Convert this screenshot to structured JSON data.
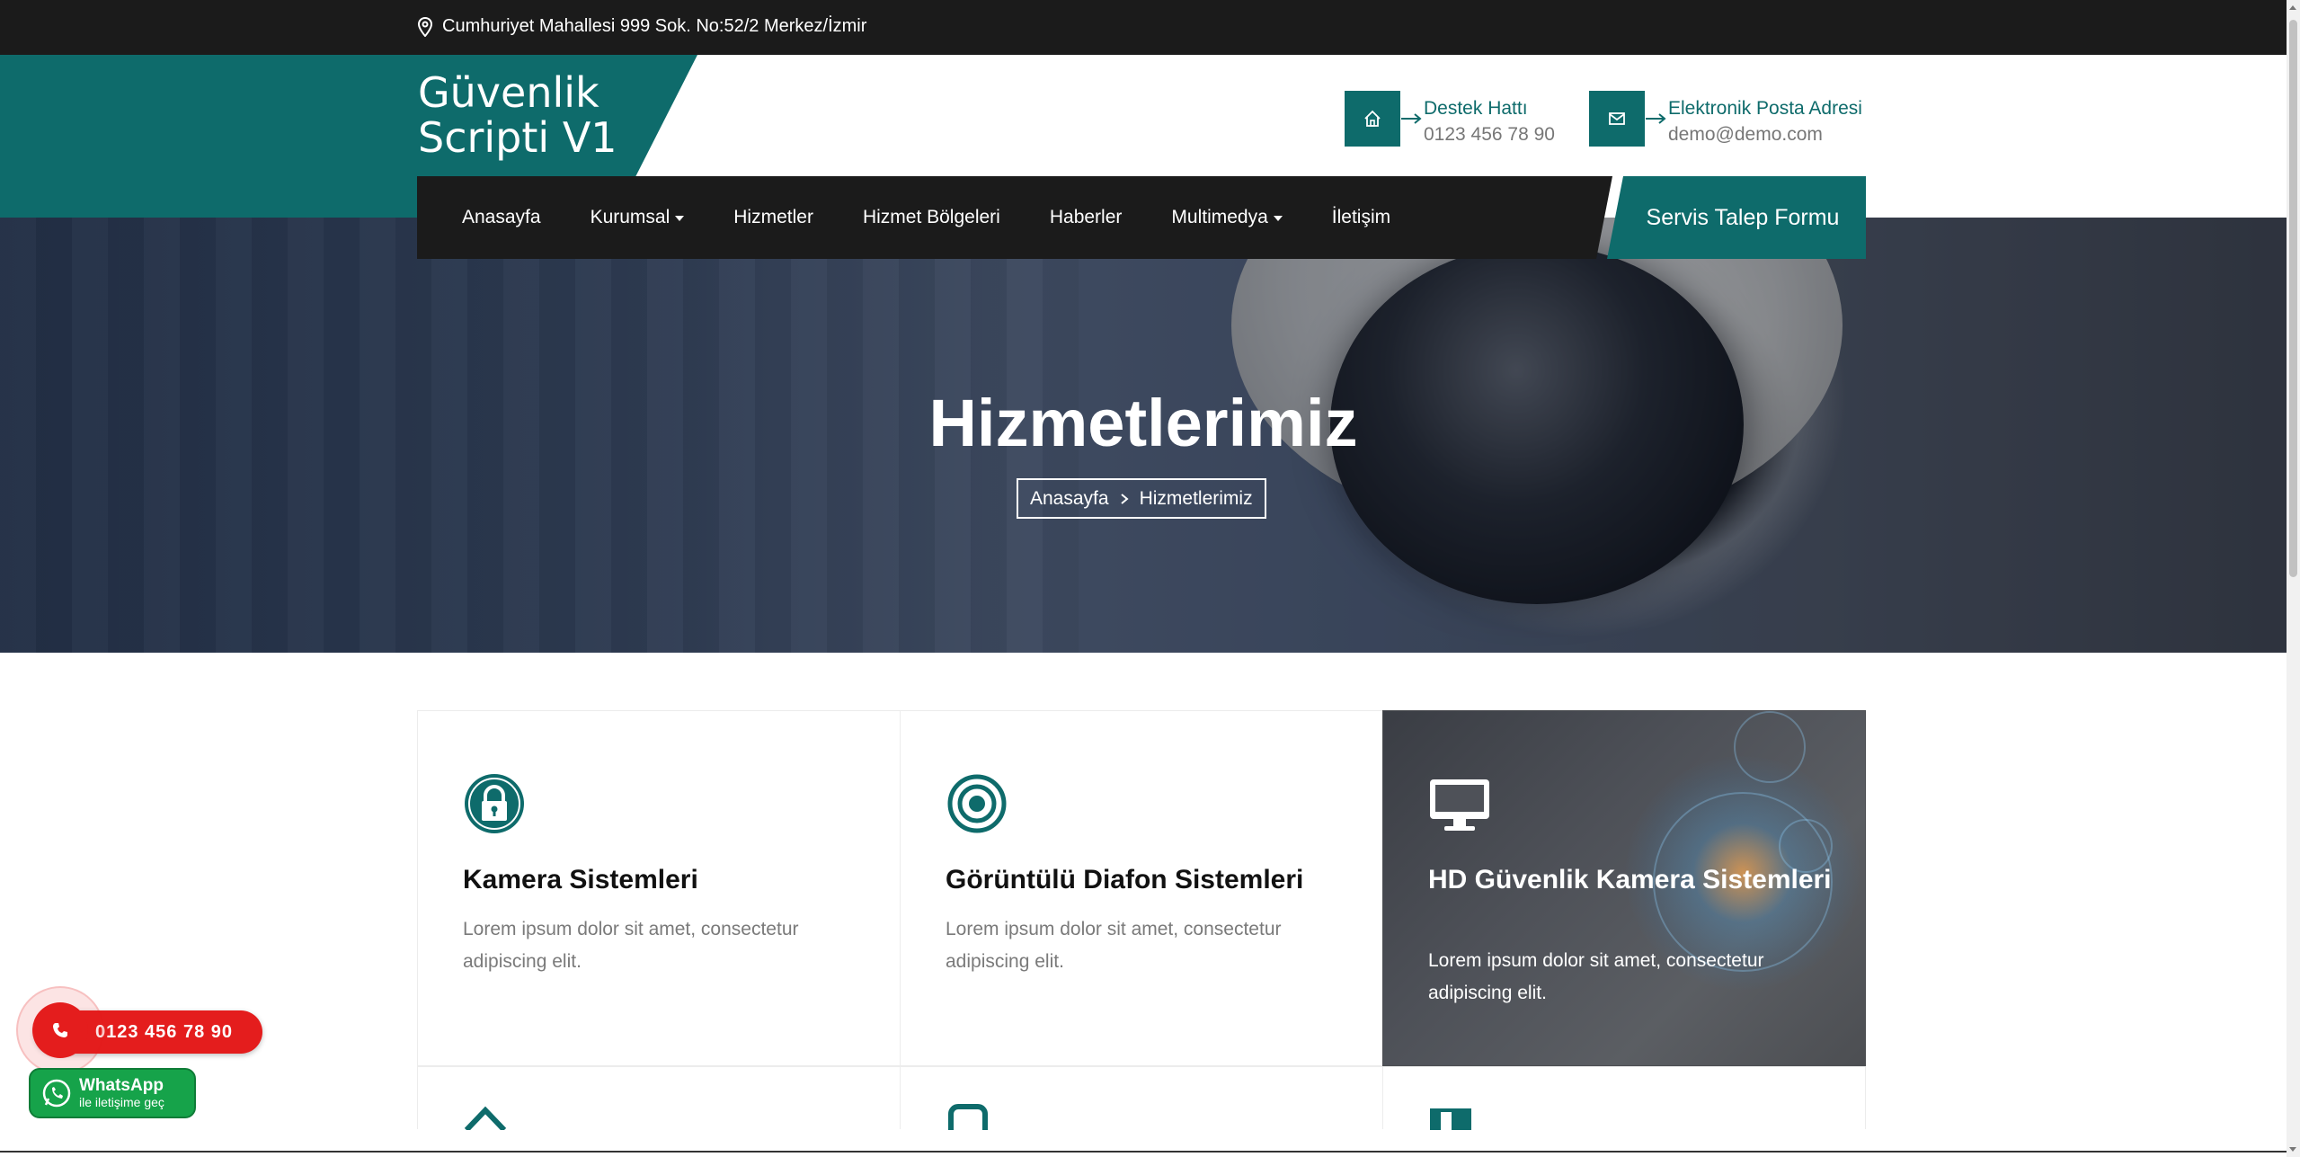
{
  "topbar": {
    "address": "Cumhuriyet Mahallesi 999 Sok. No:52/2 Merkez/İzmir",
    "icon": "map-pin-icon"
  },
  "logo": {
    "line1": "Güvenlik",
    "line2": "Scripti V1"
  },
  "contacts": {
    "support": {
      "title": "Destek Hattı",
      "value": "0123 456 78 90",
      "icon": "home-icon"
    },
    "email": {
      "title": "Elektronik Posta Adresi",
      "value": "demo@demo.com",
      "icon": "envelope-icon"
    }
  },
  "nav": {
    "items": [
      {
        "label": "Anasayfa",
        "dropdown": false
      },
      {
        "label": "Kurumsal",
        "dropdown": true
      },
      {
        "label": "Hizmetler",
        "dropdown": false
      },
      {
        "label": "Hizmet Bölgeleri",
        "dropdown": false
      },
      {
        "label": "Haberler",
        "dropdown": false
      },
      {
        "label": "Multimedya",
        "dropdown": true
      },
      {
        "label": "İletişim",
        "dropdown": false
      }
    ],
    "cta": "Servis Talep Formu"
  },
  "hero": {
    "title": "Hizmetlerimiz",
    "breadcrumb": [
      "Anasayfa",
      "Hizmetlerimiz"
    ]
  },
  "services": [
    {
      "title": "Kamera Sistemleri",
      "text": "Lorem ipsum dolor sit amet, consectetur adipiscing elit.",
      "icon": "lock-circle-icon",
      "active": false
    },
    {
      "title": "Görüntülü Diafon Sistemleri",
      "text": "Lorem ipsum dolor sit amet, consectetur adipiscing elit.",
      "icon": "target-icon",
      "active": false
    },
    {
      "title": "HD Güvenlik Kamera Sistemleri",
      "text": "Lorem ipsum dolor sit amet, consectetur adipiscing elit.",
      "icon": "monitor-icon",
      "active": true
    }
  ],
  "floating": {
    "phone": "0123 456 78 90",
    "whatsapp_line1": "WhatsApp",
    "whatsapp_line2": "ile iletişime geç"
  },
  "colors": {
    "accent": "#0e6b6b",
    "dark": "#1b1b1b",
    "call": "#e41d1d",
    "whatsapp": "#16a34a"
  }
}
